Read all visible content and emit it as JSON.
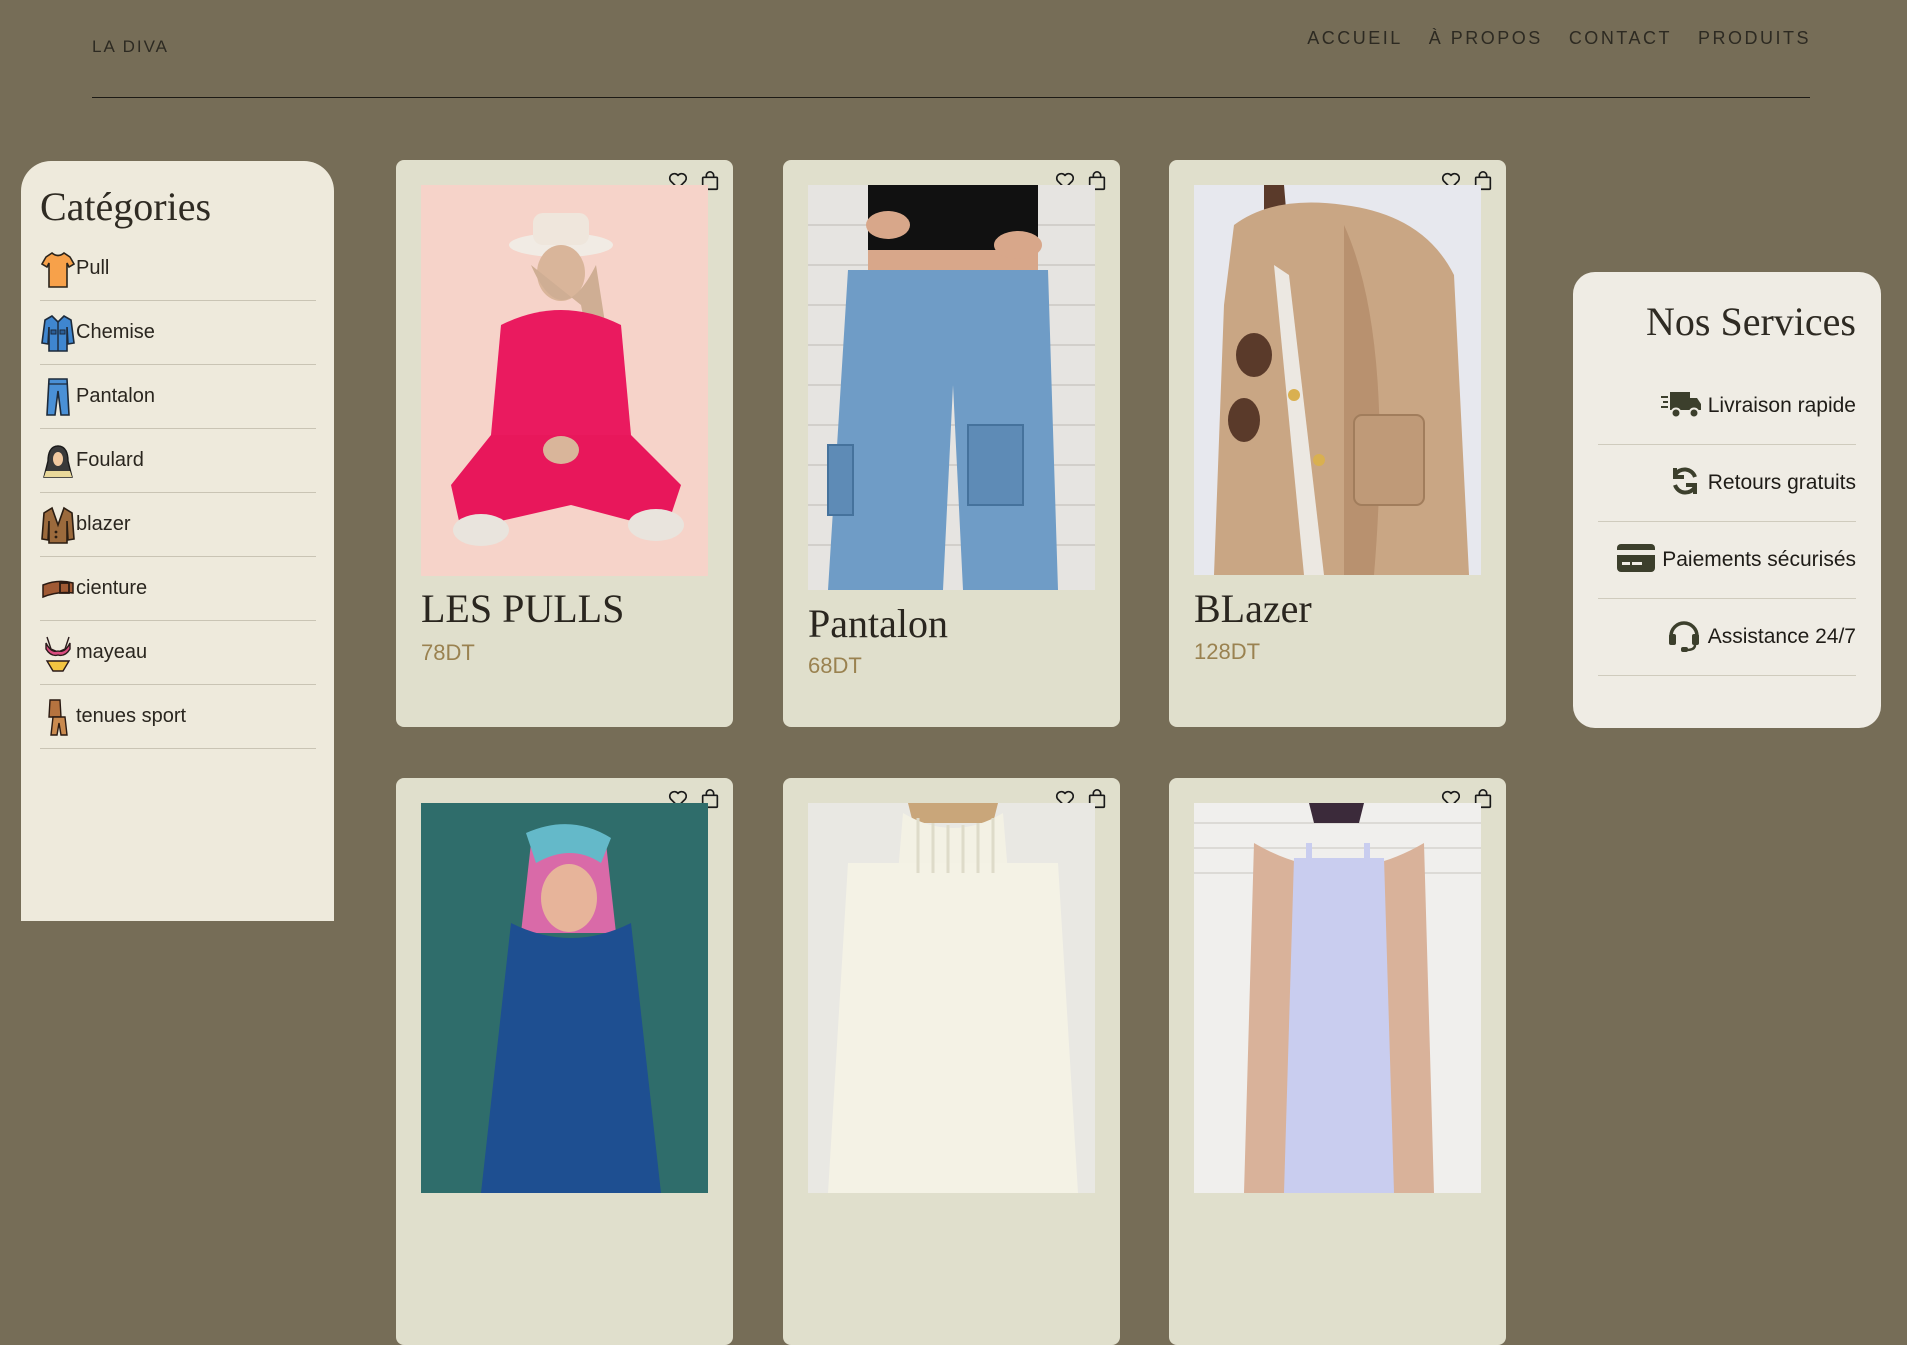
{
  "header": {
    "brand": "LA DIVA",
    "nav": [
      "ACCUEIL",
      "À PROPOS",
      "CONTACT",
      "PRODUITS"
    ]
  },
  "categories": {
    "title": "Catégories",
    "items": [
      {
        "label": "Pull",
        "icon": "pull-icon"
      },
      {
        "label": "Chemise",
        "icon": "shirt-icon"
      },
      {
        "label": "Pantalon",
        "icon": "pants-icon"
      },
      {
        "label": "Foulard",
        "icon": "headscarf-icon"
      },
      {
        "label": "blazer",
        "icon": "blazer-icon"
      },
      {
        "label": "cienture",
        "icon": "belt-icon"
      },
      {
        "label": "mayeau",
        "icon": "swimsuit-icon"
      },
      {
        "label": "tenues sport",
        "icon": "tracksuit-icon"
      }
    ]
  },
  "products": [
    {
      "title": "LES PULLS",
      "price": "78DT"
    },
    {
      "title": "Pantalon",
      "price": "68DT"
    },
    {
      "title": "BLazer",
      "price": "128DT"
    },
    {
      "title": "",
      "price": ""
    },
    {
      "title": "",
      "price": ""
    },
    {
      "title": "",
      "price": ""
    }
  ],
  "services": {
    "title": "Nos Services",
    "items": [
      {
        "label": "Livraison rapide",
        "icon": "truck-icon"
      },
      {
        "label": "Retours gratuits",
        "icon": "sync-icon"
      },
      {
        "label": "Paiements sécurisés",
        "icon": "credit-card-icon"
      },
      {
        "label": "Assistance 24/7",
        "icon": "headset-icon"
      }
    ]
  },
  "colors": {
    "background": "#766d57",
    "card": "#e0dfcc",
    "panel": "#eeeadc",
    "price": "#9a8250"
  }
}
